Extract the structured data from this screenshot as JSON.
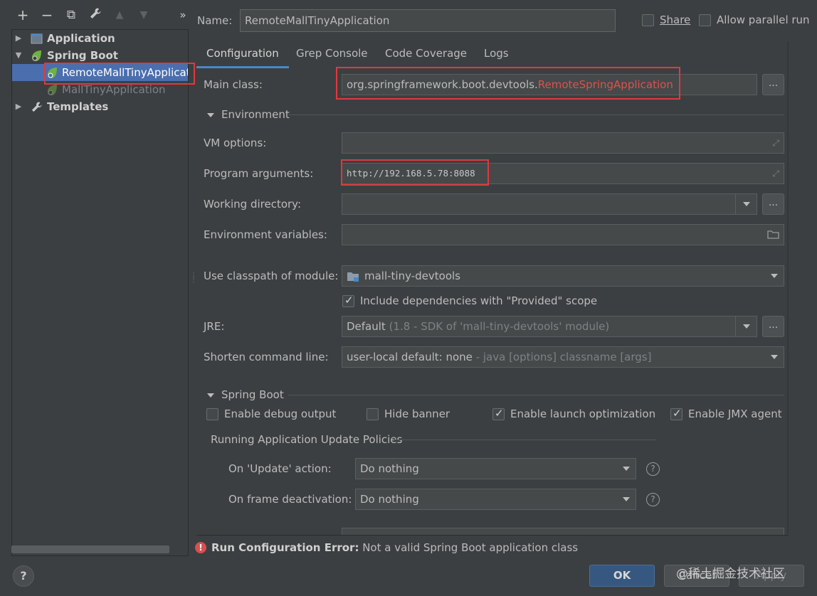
{
  "toolbar": {
    "add": "+",
    "remove": "−",
    "copy": "⧉",
    "settings": "wrench",
    "up": "▲",
    "down": "▼",
    "more": "»"
  },
  "tree": {
    "items": [
      {
        "label": "Application"
      },
      {
        "label": "Spring Boot"
      },
      {
        "label": "RemoteMallTinyApplicat"
      },
      {
        "label": "MallTinyApplication"
      },
      {
        "label": "Templates"
      }
    ]
  },
  "header": {
    "name_label": "Name:",
    "name_value": "RemoteMallTinyApplication",
    "share_label": "Share",
    "parallel_label": "Allow parallel run"
  },
  "tabs": [
    "Configuration",
    "Grep Console",
    "Code Coverage",
    "Logs"
  ],
  "form": {
    "main_class_label": "Main class:",
    "main_class_prefix": "org.springframework.boot.devtools.",
    "main_class_suffix": "RemoteSpringApplication",
    "environment_section": "Environment",
    "vm_options_label": "VM options:",
    "program_args_label": "Program arguments:",
    "program_args_value": "http://192.168.5.78:8088",
    "working_dir_label": "Working directory:",
    "env_vars_label": "Environment variables:",
    "classpath_label": "Use classpath of module:",
    "classpath_value": "mall-tiny-devtools",
    "include_deps_label": "Include dependencies with \"Provided\" scope",
    "jre_label": "JRE:",
    "jre_value": "Default",
    "jre_detail": " (1.8 - SDK of 'mall-tiny-devtools' module)",
    "shorten_label": "Shorten command line:",
    "shorten_value": "user-local default: none",
    "shorten_detail": " - java [options] classname [args]",
    "more_button": "..."
  },
  "spring_boot": {
    "section": "Spring Boot",
    "debug_output": "Enable debug output",
    "hide_banner": "Hide banner",
    "launch_opt": "Enable launch optimization",
    "jmx_agent": "Enable JMX agent",
    "policies_title": "Running Application Update Policies",
    "on_update_label": "On 'Update' action:",
    "on_update_value": "Do nothing",
    "on_frame_label": "On frame deactivation:",
    "on_frame_value": "Do nothing"
  },
  "error": {
    "title": "Run Configuration Error:",
    "message": " Not a valid Spring Boot application class"
  },
  "footer": {
    "help": "?",
    "ok": "OK",
    "cancel": "Cancel",
    "apply": "Apply",
    "watermark": "@稀土掘金技术社区"
  },
  "colors": {
    "accent": "#4a88c7",
    "selection": "#4b6eaf",
    "error_red": "#e0393e",
    "spring_green": "#6db33f"
  }
}
